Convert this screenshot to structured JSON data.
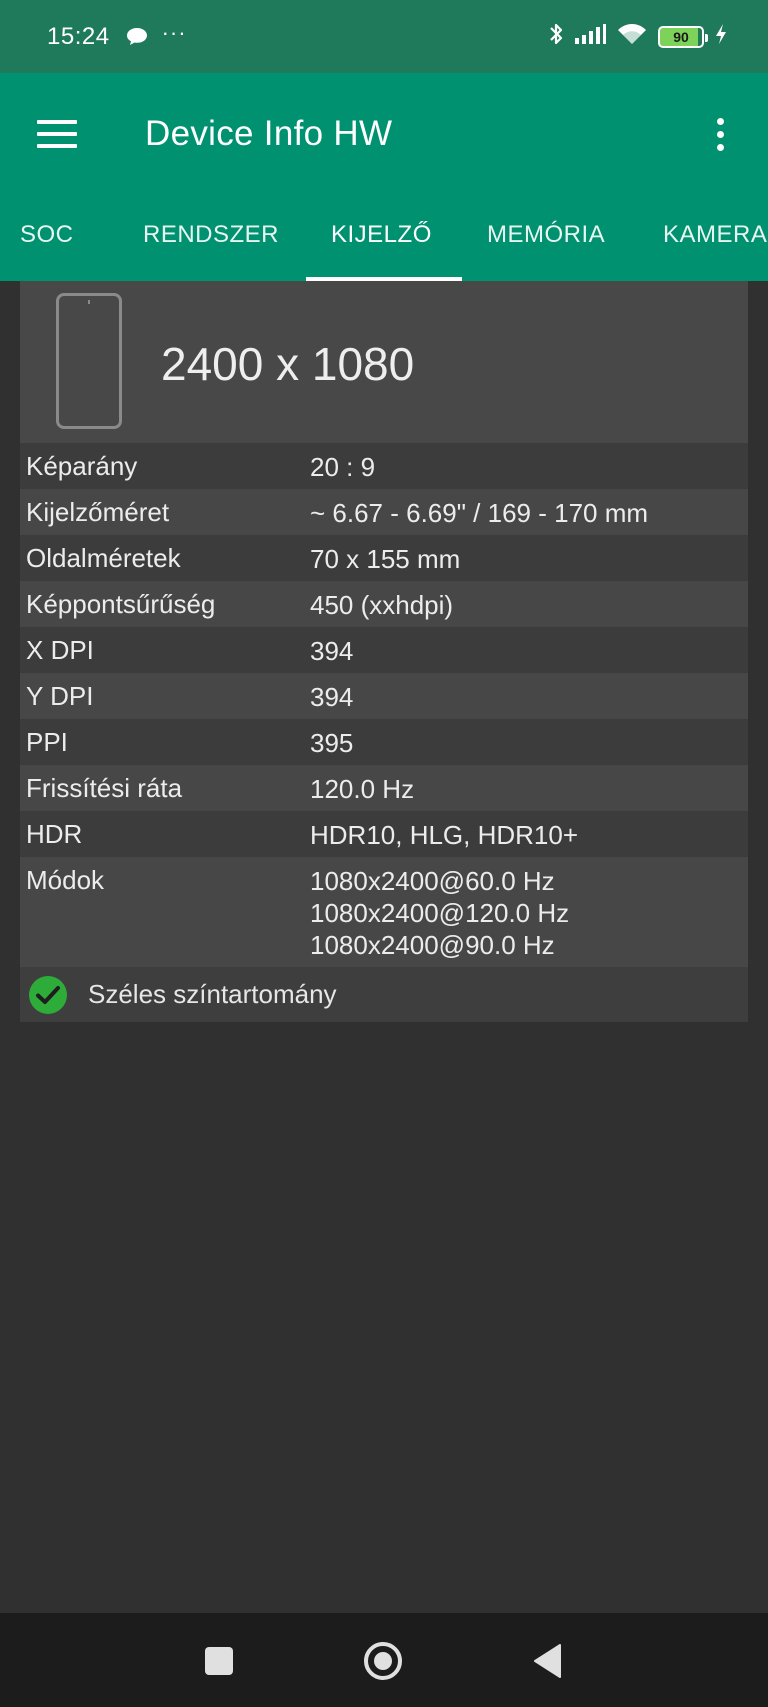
{
  "status_bar": {
    "time": "15:24",
    "more": "···",
    "battery": "90",
    "icons": [
      "chat-bubble-icon",
      "bluetooth-icon",
      "signal-icon",
      "wifi-icon",
      "battery-icon",
      "charging-icon"
    ]
  },
  "app_bar": {
    "title": "Device Info HW"
  },
  "tabs": [
    {
      "label": "SOC",
      "active": false
    },
    {
      "label": "RENDSZER",
      "active": false
    },
    {
      "label": "KIJELZŐ",
      "active": true
    },
    {
      "label": "MEMÓRIA",
      "active": false
    },
    {
      "label": "KAMERA",
      "active": false
    }
  ],
  "display": {
    "resolution": "2400 x 1080",
    "rows": [
      {
        "label": "Képarány",
        "value": "20 : 9"
      },
      {
        "label": "Kijelzőméret",
        "value": "~ 6.67 - 6.69\" / 169 - 170 mm"
      },
      {
        "label": "Oldalméretek",
        "value": "70 x 155 mm"
      },
      {
        "label": "Képpontsűrűség",
        "value": "450 (xxhdpi)"
      },
      {
        "label": "X DPI",
        "value": "394"
      },
      {
        "label": "Y DPI",
        "value": "394"
      },
      {
        "label": "PPI",
        "value": "395"
      },
      {
        "label": "Frissítési ráta",
        "value": "120.0 Hz"
      },
      {
        "label": "HDR",
        "value": "HDR10, HLG, HDR10+"
      }
    ],
    "modes": {
      "label": "Módok",
      "values": [
        "1080x2400@60.0 Hz",
        "1080x2400@120.0 Hz",
        "1080x2400@90.0 Hz"
      ]
    },
    "wide_color": "Széles színtartomány"
  },
  "colors": {
    "status_bar": "#1f7a5b",
    "primary": "#009270",
    "background": "#303030",
    "check_green": "#2eac3a"
  }
}
